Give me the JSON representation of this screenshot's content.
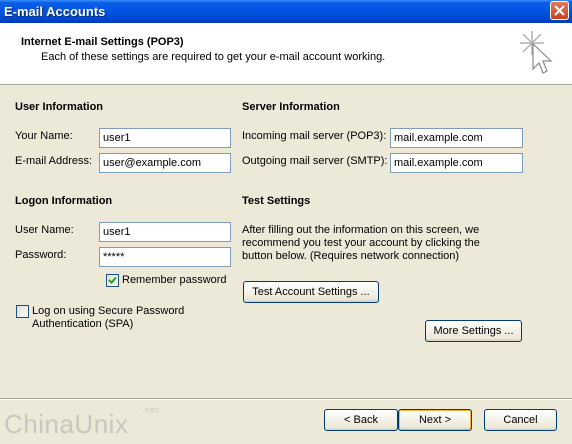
{
  "window": {
    "title": "E-mail Accounts"
  },
  "header": {
    "title": "Internet E-mail Settings (POP3)",
    "subtitle": "Each of these settings are required to get your e-mail account working."
  },
  "user_info": {
    "section_title": "User Information",
    "name_label": "Your Name:",
    "name_value": "user1",
    "email_label": "E-mail Address:",
    "email_value": "user@example.com"
  },
  "server_info": {
    "section_title": "Server Information",
    "incoming_label": "Incoming mail server (POP3):",
    "incoming_value": "mail.example.com",
    "outgoing_label": "Outgoing mail server (SMTP):",
    "outgoing_value": "mail.example.com"
  },
  "logon_info": {
    "section_title": "Logon Information",
    "username_label": "User Name:",
    "username_value": "user1",
    "password_label": "Password:",
    "password_value": "*****",
    "remember_label": "Remember password",
    "remember_checked": true,
    "spa_label_line1": "Log on using Secure Password",
    "spa_label_line2": "Authentication (SPA)",
    "spa_checked": false
  },
  "test_settings": {
    "section_title": "Test Settings",
    "description": "After filling out the information on this screen, we recommend you test your account by clicking the button below. (Requires network connection)",
    "test_button": "Test Account Settings ..."
  },
  "more_settings_button": "More Settings ...",
  "footer": {
    "back_button": "< Back",
    "next_button": "Next >",
    "cancel_button": "Cancel",
    "watermark": "ChinaUnix",
    "watermark_suffix": ".net"
  }
}
